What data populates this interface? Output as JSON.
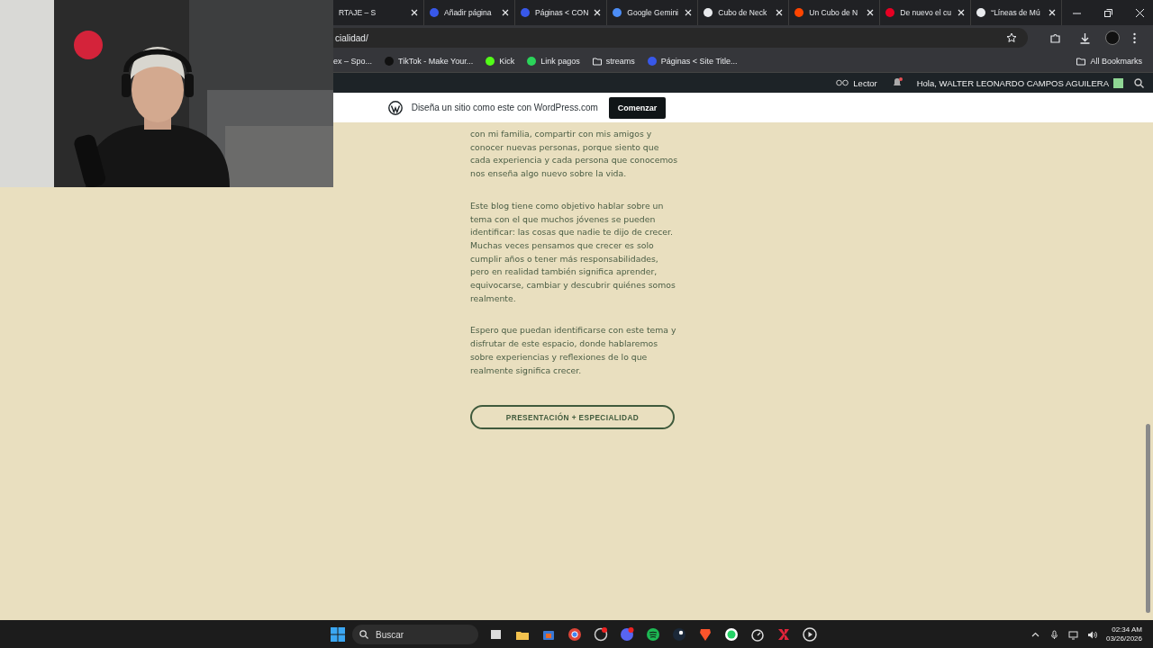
{
  "browser": {
    "tabs": [
      {
        "label": "RTAJE – S",
        "selected": false
      },
      {
        "label": "Añadir página",
        "selected": false,
        "color": "#3858e9"
      },
      {
        "label": "Páginas < CON",
        "selected": false,
        "color": "#3858e9"
      },
      {
        "label": "Google Gemini",
        "selected": false,
        "color": "#4c8df6"
      },
      {
        "label": "Cubo de Neck",
        "selected": false,
        "color": "#e8eaed"
      },
      {
        "label": "Un Cubo de N",
        "selected": false,
        "color": "#ff4500"
      },
      {
        "label": "De nuevo el cu",
        "selected": false,
        "color": "#e60023"
      },
      {
        "label": "“Líneas de Mú",
        "selected": false,
        "color": "#e8eaed"
      }
    ],
    "address": "cialidad/",
    "bookmarks": [
      {
        "label": "ex – Spo...",
        "kind": "plain"
      },
      {
        "label": "TikTok - Make Your...",
        "kind": "site",
        "color": "#111111"
      },
      {
        "label": "Kick",
        "kind": "site",
        "color": "#53fc18"
      },
      {
        "label": "Link pagos",
        "kind": "site",
        "color": "#2bd45a"
      },
      {
        "label": "streams",
        "kind": "folder"
      },
      {
        "label": "Páginas < Site Title...",
        "kind": "site",
        "color": "#3858e9"
      }
    ],
    "all_bookmarks": "All Bookmarks"
  },
  "admin_bar": {
    "reader": "Lector",
    "greeting": "Hola, WALTER LEONARDO CAMPOS AGUILERA"
  },
  "banner": {
    "text": "Diseña un sitio como este con WordPress.com",
    "button": "Comenzar"
  },
  "page": {
    "paragraphs": [
      "con mi familia, compartir con mis amigos y conocer nuevas personas, porque siento que cada experiencia y cada persona que conocemos nos enseña algo nuevo sobre la vida.",
      "Este blog tiene como objetivo hablar sobre un tema con el que muchos jóvenes se pueden identificar: las cosas que nadie te dijo de crecer. Muchas veces pensamos que crecer es solo cumplir años o tener más responsabilidades, pero en realidad también significa aprender, equivocarse, cambiar y descubrir quiénes somos realmente.",
      "Espero que puedan identificarse con este tema y disfrutar de este espacio, donde hablaremos sobre experiencias y reflexiones de lo que realmente significa crecer."
    ],
    "button": "PRESENTACIÓN + ESPECIALIDAD"
  },
  "taskbar": {
    "search": "Buscar",
    "time": "02:34 AM",
    "date": "03/26/2026"
  }
}
